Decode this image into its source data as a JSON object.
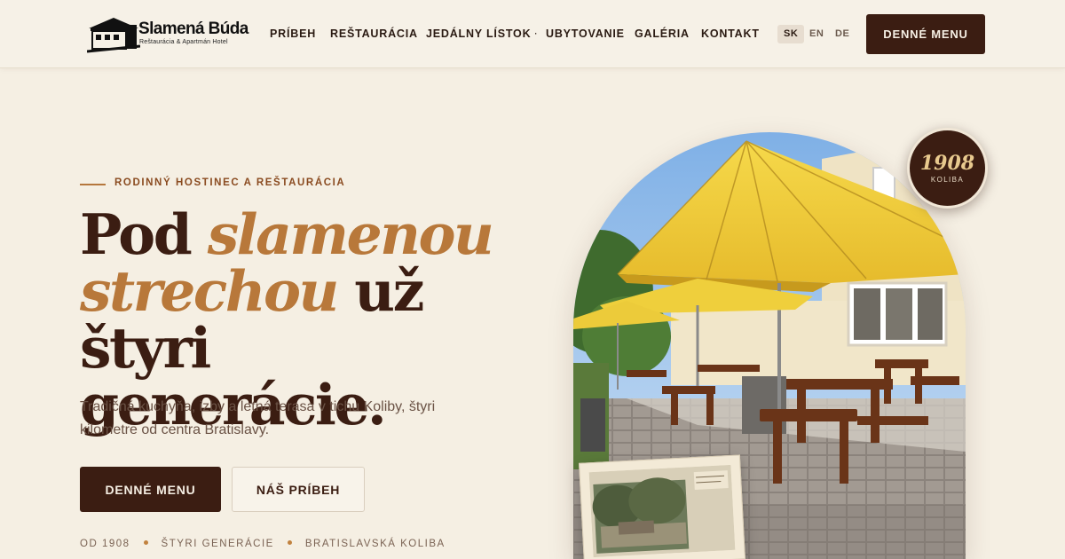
{
  "brand": {
    "name": "Slamená Búda",
    "tagline": "Reštaurácia & Apartmán Hotel"
  },
  "nav": {
    "items": [
      {
        "label": "PRÍBEH",
        "has_dropdown": false
      },
      {
        "label": "REŠTAURÁCIA",
        "has_dropdown": false
      },
      {
        "label": "JEDÁLNY LÍSTOK",
        "has_dropdown": true
      },
      {
        "label": "UBYTOVANIE",
        "has_dropdown": false
      },
      {
        "label": "GALÉRIA",
        "has_dropdown": false
      },
      {
        "label": "KONTAKT",
        "has_dropdown": false
      }
    ],
    "dropdown_caret": "·",
    "languages": [
      {
        "code": "SK",
        "active": true
      },
      {
        "code": "EN",
        "active": false
      },
      {
        "code": "DE",
        "active": false
      }
    ],
    "cta_label": "DENNÉ MENU"
  },
  "hero": {
    "eyebrow": "RODINNÝ HOSTINEC A REŠTAURÁCIA",
    "headline": {
      "part1": "Pod ",
      "accent1": "slamenou",
      "accent2": "strechou",
      "part2": " už štyri",
      "part3": "generácie."
    },
    "lead": "Tradičná kuchyňa, izby a letná terasa v tichu Koliby, štyri kilometre od centra Bratislavy.",
    "primary_button": "DENNÉ MENU",
    "secondary_button": "NÁŠ PRÍBEH",
    "facts": [
      "OD 1908",
      "ŠTYRI GENERÁCIE",
      "BRATISLAVSKÁ KOLIBA"
    ]
  },
  "badge": {
    "year": "1908",
    "label": "KOLIBA"
  },
  "colors": {
    "background": "#f5efe3",
    "primary_dark": "#3b1d12",
    "accent": "#b8783a",
    "umbrella_yellow": "#f0cc3a"
  },
  "icons": [
    "logo-house-icon",
    "chevron-down-icon",
    "bullet-dot-icon"
  ]
}
